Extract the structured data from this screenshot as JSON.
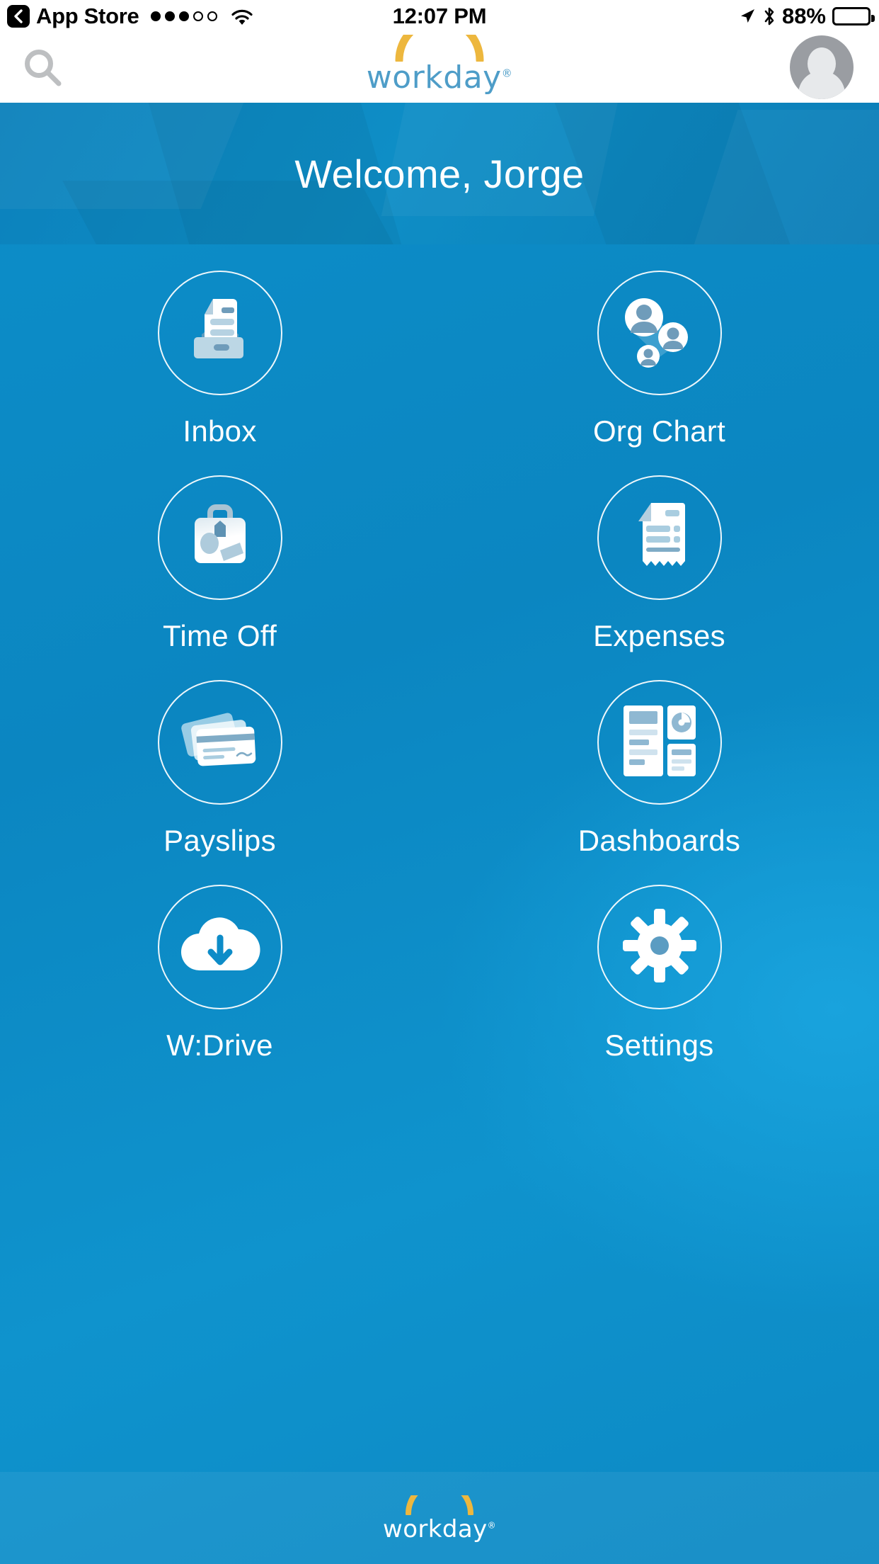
{
  "status_bar": {
    "back_label": "App Store",
    "back_icon": "chevron-left-icon",
    "signal_icon": "signal-dots-icon",
    "signal_bars_filled": 3,
    "signal_bars_total": 5,
    "wifi_icon": "wifi-icon",
    "time": "12:07 PM",
    "location_icon": "location-arrow-icon",
    "bluetooth_icon": "bluetooth-icon",
    "battery_percent": "88%",
    "battery_icon": "battery-icon",
    "battery_level": 88
  },
  "nav": {
    "search_icon": "search-icon",
    "logo_text": "workday",
    "logo_trademark": "®",
    "logo_arc_icon": "workday-arc-icon",
    "avatar_icon": "user-avatar-icon"
  },
  "banner": {
    "title": "Welcome, Jorge"
  },
  "grid": {
    "tiles": [
      {
        "label": "Inbox",
        "icon": "inbox-tray-icon"
      },
      {
        "label": "Org Chart",
        "icon": "org-chart-people-icon"
      },
      {
        "label": "Time Off",
        "icon": "suitcase-icon"
      },
      {
        "label": "Expenses",
        "icon": "receipt-icon"
      },
      {
        "label": "Payslips",
        "icon": "payment-cards-icon"
      },
      {
        "label": "Dashboards",
        "icon": "dashboard-grid-icon"
      },
      {
        "label": "W:Drive",
        "icon": "cloud-download-icon"
      },
      {
        "label": "Settings",
        "icon": "gear-icon"
      }
    ]
  },
  "footer": {
    "logo_text": "workday",
    "logo_trademark": "®",
    "logo_arc_icon": "workday-arc-icon"
  },
  "colors": {
    "brand_blue": "#4e9dc8",
    "brand_gold": "#edb73e",
    "background_blue": "#0d8cc8",
    "banner_blue": "#0c81bc",
    "icon_white": "#ffffff",
    "icon_steel": "#6f9cba",
    "icon_pale": "#bcd6e4",
    "status_black": "#000000",
    "avatar_gray": "#9a9da2"
  }
}
